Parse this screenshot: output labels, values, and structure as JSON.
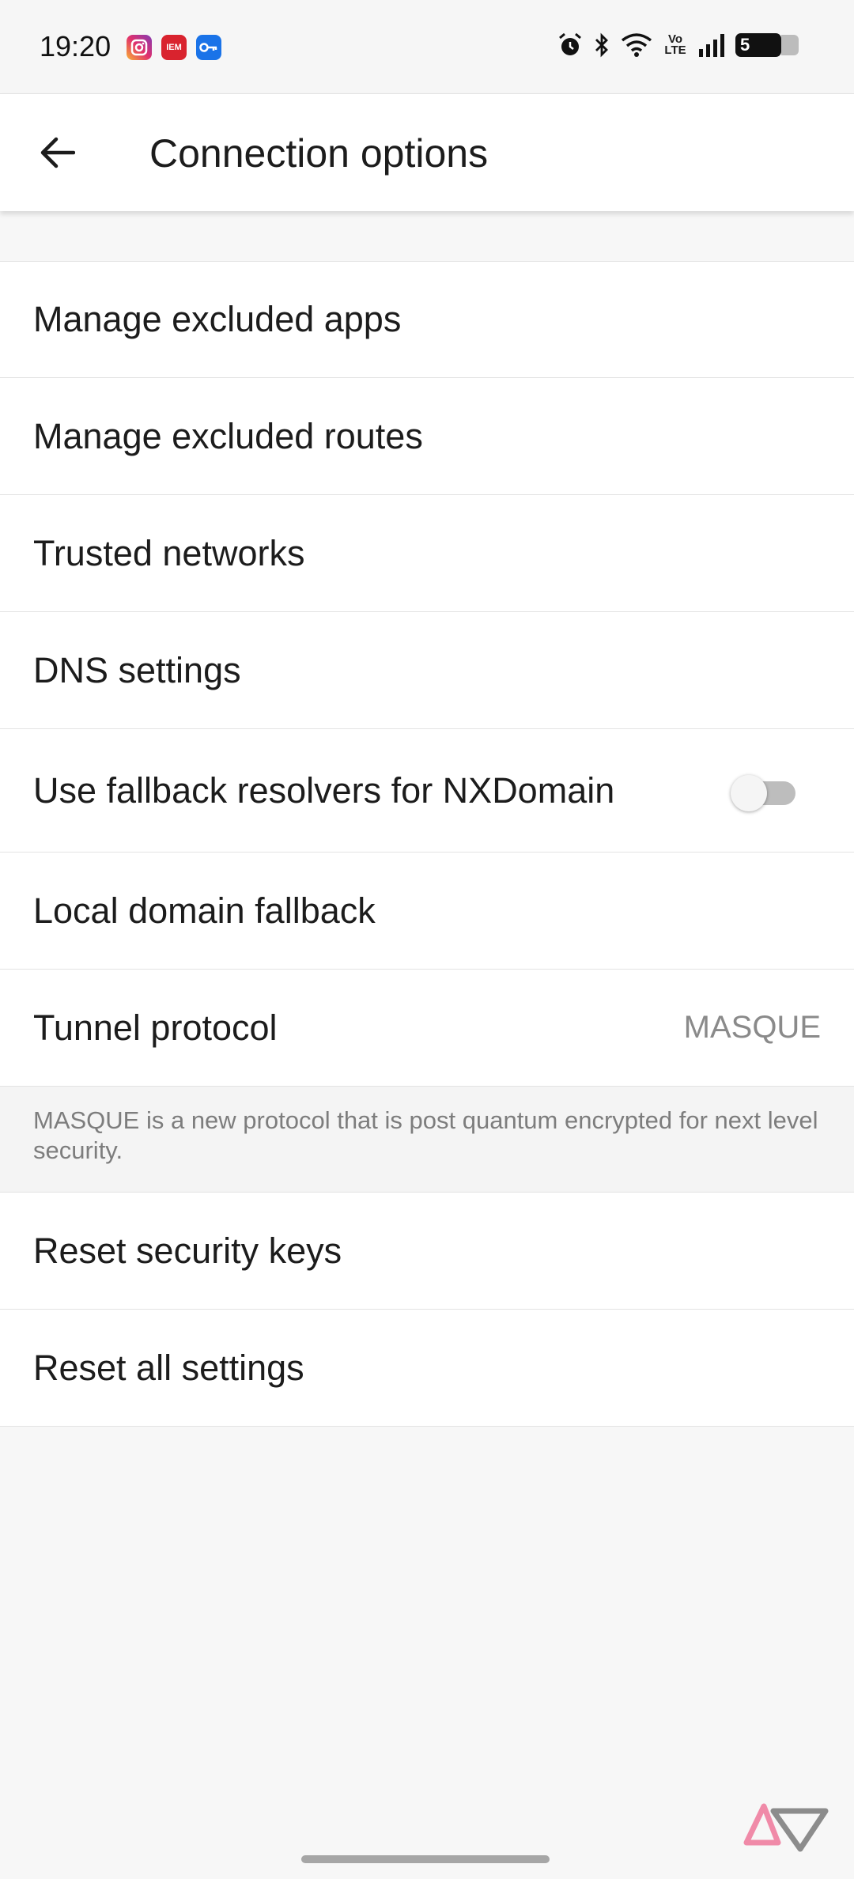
{
  "status_bar": {
    "time": "19:20",
    "notification_icons": [
      "instagram-icon",
      "iem-app-icon",
      "vpn-key-icon"
    ],
    "iem_label": "IEM",
    "network_label": "Vo LTE",
    "battery_level": "55",
    "battery_text": "5"
  },
  "app_bar": {
    "title": "Connection options",
    "back_icon": "arrow-back-icon"
  },
  "settings": {
    "manage_excluded_apps": "Manage excluded apps",
    "manage_excluded_routes": "Manage excluded routes",
    "trusted_networks": "Trusted networks",
    "dns_settings": "DNS settings",
    "fallback_resolvers": "Use fallback resolvers for NXDomain",
    "fallback_resolvers_enabled": false,
    "local_domain_fallback": "Local domain fallback",
    "tunnel_protocol": "Tunnel protocol",
    "tunnel_protocol_value": "MASQUE",
    "tunnel_protocol_note": "MASQUE is a new protocol that is post quantum encrypted for next level security.",
    "reset_security_keys": "Reset security keys",
    "reset_all_settings": "Reset all settings"
  }
}
